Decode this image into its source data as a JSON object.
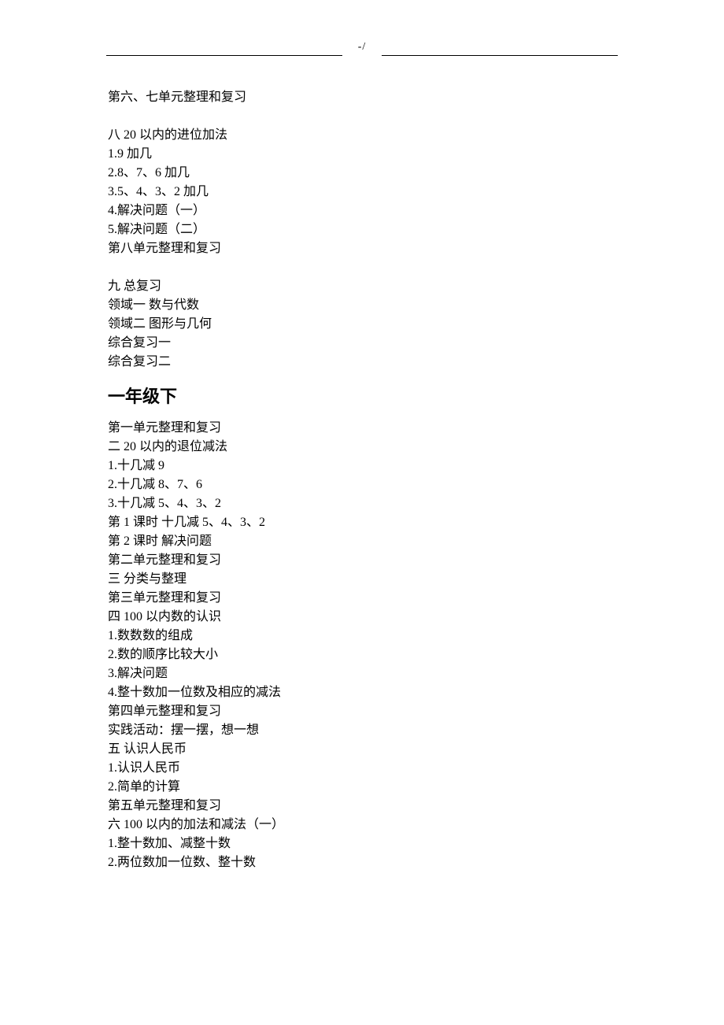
{
  "header": {
    "label": "-/"
  },
  "block1": {
    "line1": "第六、七单元整理和复习"
  },
  "block2": {
    "title": "八 20 以内的进位加法",
    "items": [
      "1.9 加几",
      "2.8、7、6 加几",
      "3.5、4、3、2 加几",
      "4.解决问题（一）",
      "5.解决问题（二）",
      "第八单元整理和复习"
    ]
  },
  "block3": {
    "title": "九 总复习",
    "items": [
      "领域一 数与代数",
      "领域二 图形与几何",
      "综合复习一",
      "综合复习二"
    ]
  },
  "grade_heading": "一年级下",
  "block4": {
    "items": [
      "第一单元整理和复习",
      "二 20 以内的退位减法",
      "1.十几减 9",
      "2.十几减 8、7、6",
      "3.十几减 5、4、3、2",
      "第 1 课时 十几减 5、4、3、2",
      "第 2 课时 解决问题",
      "第二单元整理和复习",
      "三 分类与整理",
      "第三单元整理和复习",
      "四 100 以内数的认识",
      "1.数数数的组成",
      "2.数的顺序比较大小",
      "3.解决问题",
      "4.整十数加一位数及相应的减法",
      "第四单元整理和复习",
      "实践活动：摆一摆，想一想",
      "五 认识人民币",
      "1.认识人民币",
      "2.简单的计算",
      "第五单元整理和复习",
      "六 100 以内的加法和减法（一）",
      "1.整十数加、减整十数",
      "2.两位数加一位数、整十数"
    ]
  }
}
